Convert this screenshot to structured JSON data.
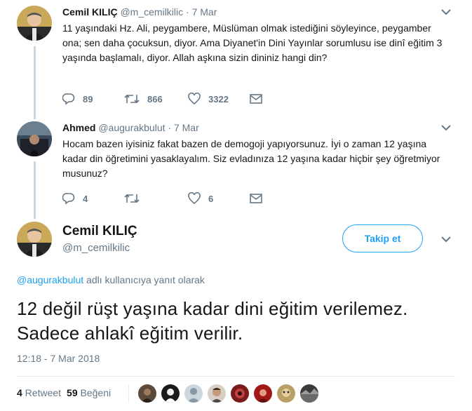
{
  "tweet1": {
    "name": "Cemil KILIÇ",
    "handle": "@m_cemilkilic",
    "dot": "·",
    "time": "7 Mar",
    "text": "11 yaşındaki Hz. Ali, peygambere, Müslüman olmak istediğini söyleyince, peygamber ona; sen daha çocuksun, diyor. Ama Diyanet'in Dini Yayınlar sorumlusu ise dinî eğitim 3 yaşında başlamalı, diyor. Allah aşkına sizin dininiz hangi din?",
    "replies": "89",
    "retweets": "866",
    "likes": "3322"
  },
  "tweet2": {
    "name": "Ahmed",
    "handle": "@augurakbulut",
    "dot": "·",
    "time": "7 Mar",
    "text": "Hocam bazen iyisiniz fakat bazen de demogoji yapıyorsunuz. İyi o zaman 12 yaşına kadar din öğretimini yasaklayalım. Siz evladınıza 12 yaşına kadar hiçbir şey öğretmiyor musunuz?",
    "replies": "4",
    "retweets": "",
    "likes": "6"
  },
  "main_tweet": {
    "name": "Cemil KILIÇ",
    "handle": "@m_cemilkilic",
    "follow_label": "Takip et",
    "reply_mention": "@augurakbulut",
    "reply_suffix": " adlı kullanıcıya yanıt olarak",
    "text": "12 değil rüşt yaşına kadar dini eğitim verilemez. Sadece ahlakî eğitim verilir.",
    "timestamp": "12:18 - 7 Mar 2018",
    "retweet_count": "4",
    "retweet_label": " Retweet ",
    "like_count": "59",
    "like_label": " Beğeni"
  },
  "colors": {
    "accent": "#1da1f2",
    "muted": "#657786",
    "text": "#14171a",
    "line": "#ccd6dd"
  }
}
